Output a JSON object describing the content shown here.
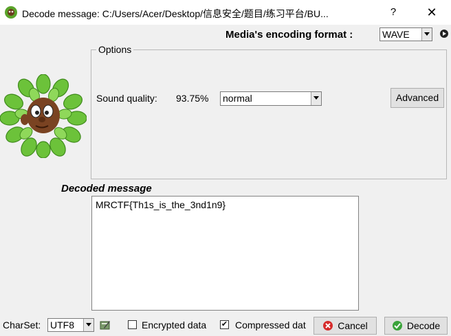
{
  "window": {
    "title": "Decode message: C:/Users/Acer/Desktop/信息安全/题目/练习平台/BU...",
    "help_label": "?",
    "close_label": "✕"
  },
  "encoding": {
    "label": "Media's encoding format :",
    "selected": "WAVE"
  },
  "options": {
    "group_title": "Options",
    "sound_quality_label": "Sound quality:",
    "sound_quality_value": "93.75%",
    "quality_selected": "normal",
    "advanced_label": "Advanced"
  },
  "decoded": {
    "label": "Decoded message",
    "text": "MRCTF{Th1s_is_the_3nd1n9}"
  },
  "bottom": {
    "charset_label": "CharSet:",
    "charset_selected": "UTF8",
    "encrypted_label": "Encrypted data",
    "encrypted_checked": false,
    "compressed_label": "Compressed dat",
    "compressed_checked": true,
    "check_mark": "✔",
    "cancel_label": "Cancel",
    "decode_label": "Decode"
  }
}
